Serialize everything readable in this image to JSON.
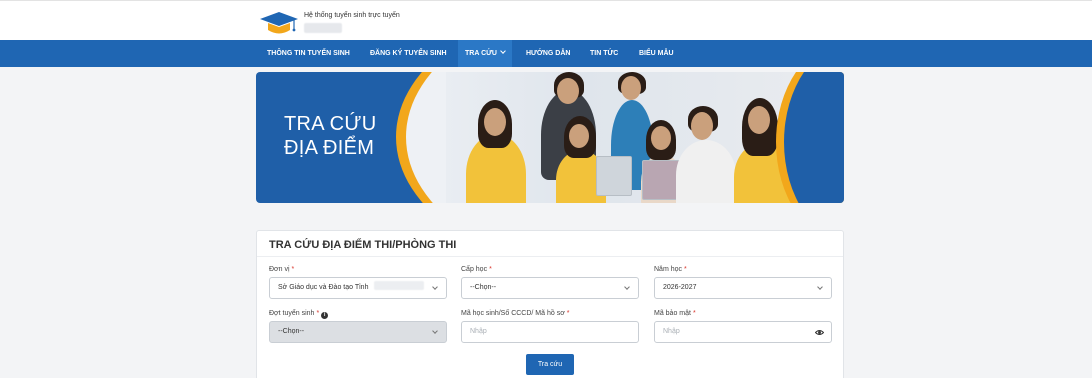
{
  "header": {
    "site_title": "Hệ thống tuyển sinh trực tuyến"
  },
  "nav": {
    "items": [
      {
        "label": "THÔNG TIN TUYỂN SINH"
      },
      {
        "label": "ĐĂNG KÝ TUYỂN SINH"
      },
      {
        "label": "TRA CỨU"
      },
      {
        "label": "HƯỚNG DẪN"
      },
      {
        "label": "TIN TỨC"
      },
      {
        "label": "BIỂU MẪU"
      }
    ],
    "active": "TRA CỨU"
  },
  "banner": {
    "line1": "TRA CỨU",
    "line2": "ĐỊA ĐIỂM"
  },
  "form": {
    "title": "TRA CỨU ĐỊA ĐIỂM THI/PHÒNG THI",
    "unit": {
      "label": "Đơn vị",
      "value": "Sở Giáo dục và Đào tạo Tỉnh"
    },
    "level": {
      "label": "Cấp học",
      "value": "--Chọn--"
    },
    "year": {
      "label": "Năm học",
      "value": "2026-2027"
    },
    "round": {
      "label": "Đợt tuyển sinh",
      "value": "--Chọn--"
    },
    "student_id": {
      "label": "Mã học sinh/Số CCCD/ Mã hồ sơ",
      "placeholder": "Nhập"
    },
    "security": {
      "label": "Mã bảo mật",
      "placeholder": "Nhập"
    },
    "required_mark": "*",
    "submit_label": "Tra cứu"
  },
  "colors": {
    "primary": "#1f66b3",
    "accent": "#f2a71b",
    "required": "#d9342b"
  }
}
